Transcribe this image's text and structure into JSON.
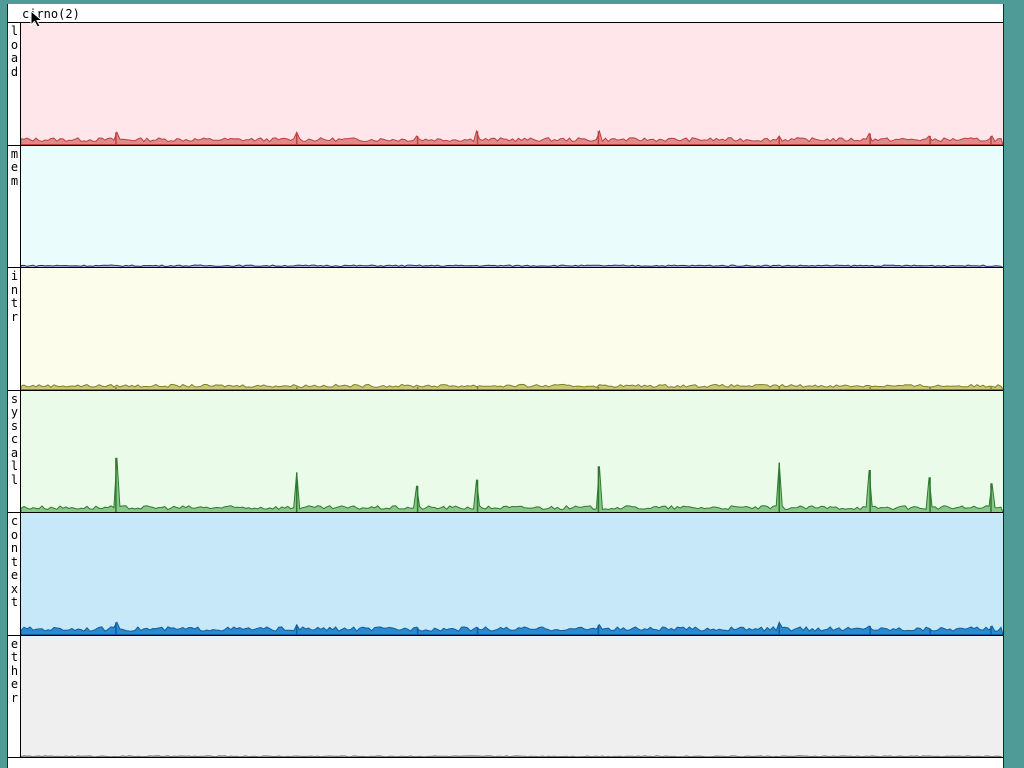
{
  "window": {
    "title": "cirno(2)"
  },
  "panels": [
    {
      "id": "load",
      "label": "load",
      "bg": "#ffe6ea",
      "line": "#c04040",
      "fill": "#e08a8a"
    },
    {
      "id": "mem",
      "label": "mem",
      "bg": "#eafcfc",
      "line": "#303078",
      "fill": "#a8b0e0"
    },
    {
      "id": "intr",
      "label": "intr",
      "bg": "#fdfdec",
      "line": "#808020",
      "fill": "#c8c878"
    },
    {
      "id": "syscall",
      "label": "syscall",
      "bg": "#eafbea",
      "line": "#2e7a2e",
      "fill": "#88c888"
    },
    {
      "id": "context",
      "label": "context",
      "bg": "#c6e8f8",
      "line": "#1060a0",
      "fill": "#2a8ad0"
    },
    {
      "id": "ether",
      "label": "ether",
      "bg": "#efefef",
      "line": "#707070",
      "fill": "#b0b0b0"
    }
  ],
  "spike_positions": [
    95,
    276,
    397,
    457,
    578,
    759,
    850,
    910,
    971
  ],
  "spike_levels": {
    "load": [
      0.1,
      0.1,
      0.07,
      0.11,
      0.11,
      0.07,
      0.09,
      0.07,
      0.07
    ],
    "mem": [],
    "intr": [
      0.02,
      0.02,
      0.02,
      0.02,
      0.02,
      0.02,
      0.02,
      0.02,
      0.02
    ],
    "syscall": [
      0.45,
      0.33,
      0.22,
      0.27,
      0.38,
      0.41,
      0.35,
      0.29,
      0.24
    ],
    "context": [
      0.1,
      0.08,
      0.06,
      0.06,
      0.08,
      0.1,
      0.07,
      0.05,
      0.07
    ],
    "ether": []
  },
  "base_levels": {
    "load": 0.04,
    "mem": 0.015,
    "intr": 0.03,
    "syscall": 0.04,
    "context": 0.045,
    "ether": 0.01
  }
}
